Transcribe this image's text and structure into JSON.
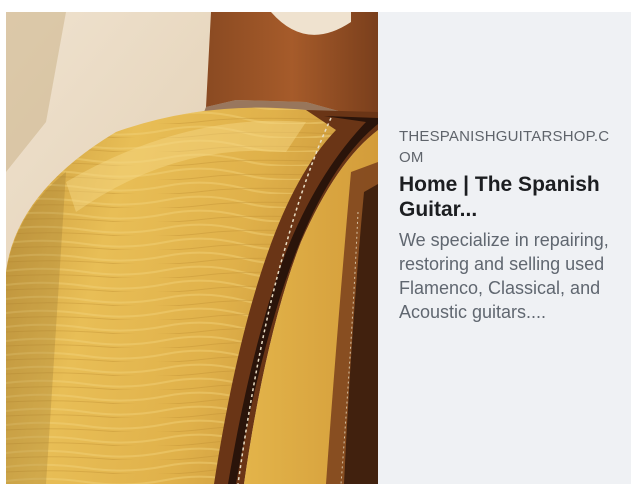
{
  "link_preview": {
    "domain": "THESPANISHGUITARSHOP.COM",
    "title": "Home | The Spanish Guitar...",
    "description": "We specialize in repairing, restoring and selling used Flamenco, Classical, and Acoustic guitars....",
    "image": {
      "subject": "guitar-body-photo"
    }
  },
  "colors": {
    "card_background": "#eff1f4",
    "domain_text": "#5f646b",
    "title_text": "#1c1e21",
    "description_text": "#606770",
    "spruce_top": "#e2b547",
    "rosewood": "#6a3516",
    "wall": "#e8d6bd"
  }
}
